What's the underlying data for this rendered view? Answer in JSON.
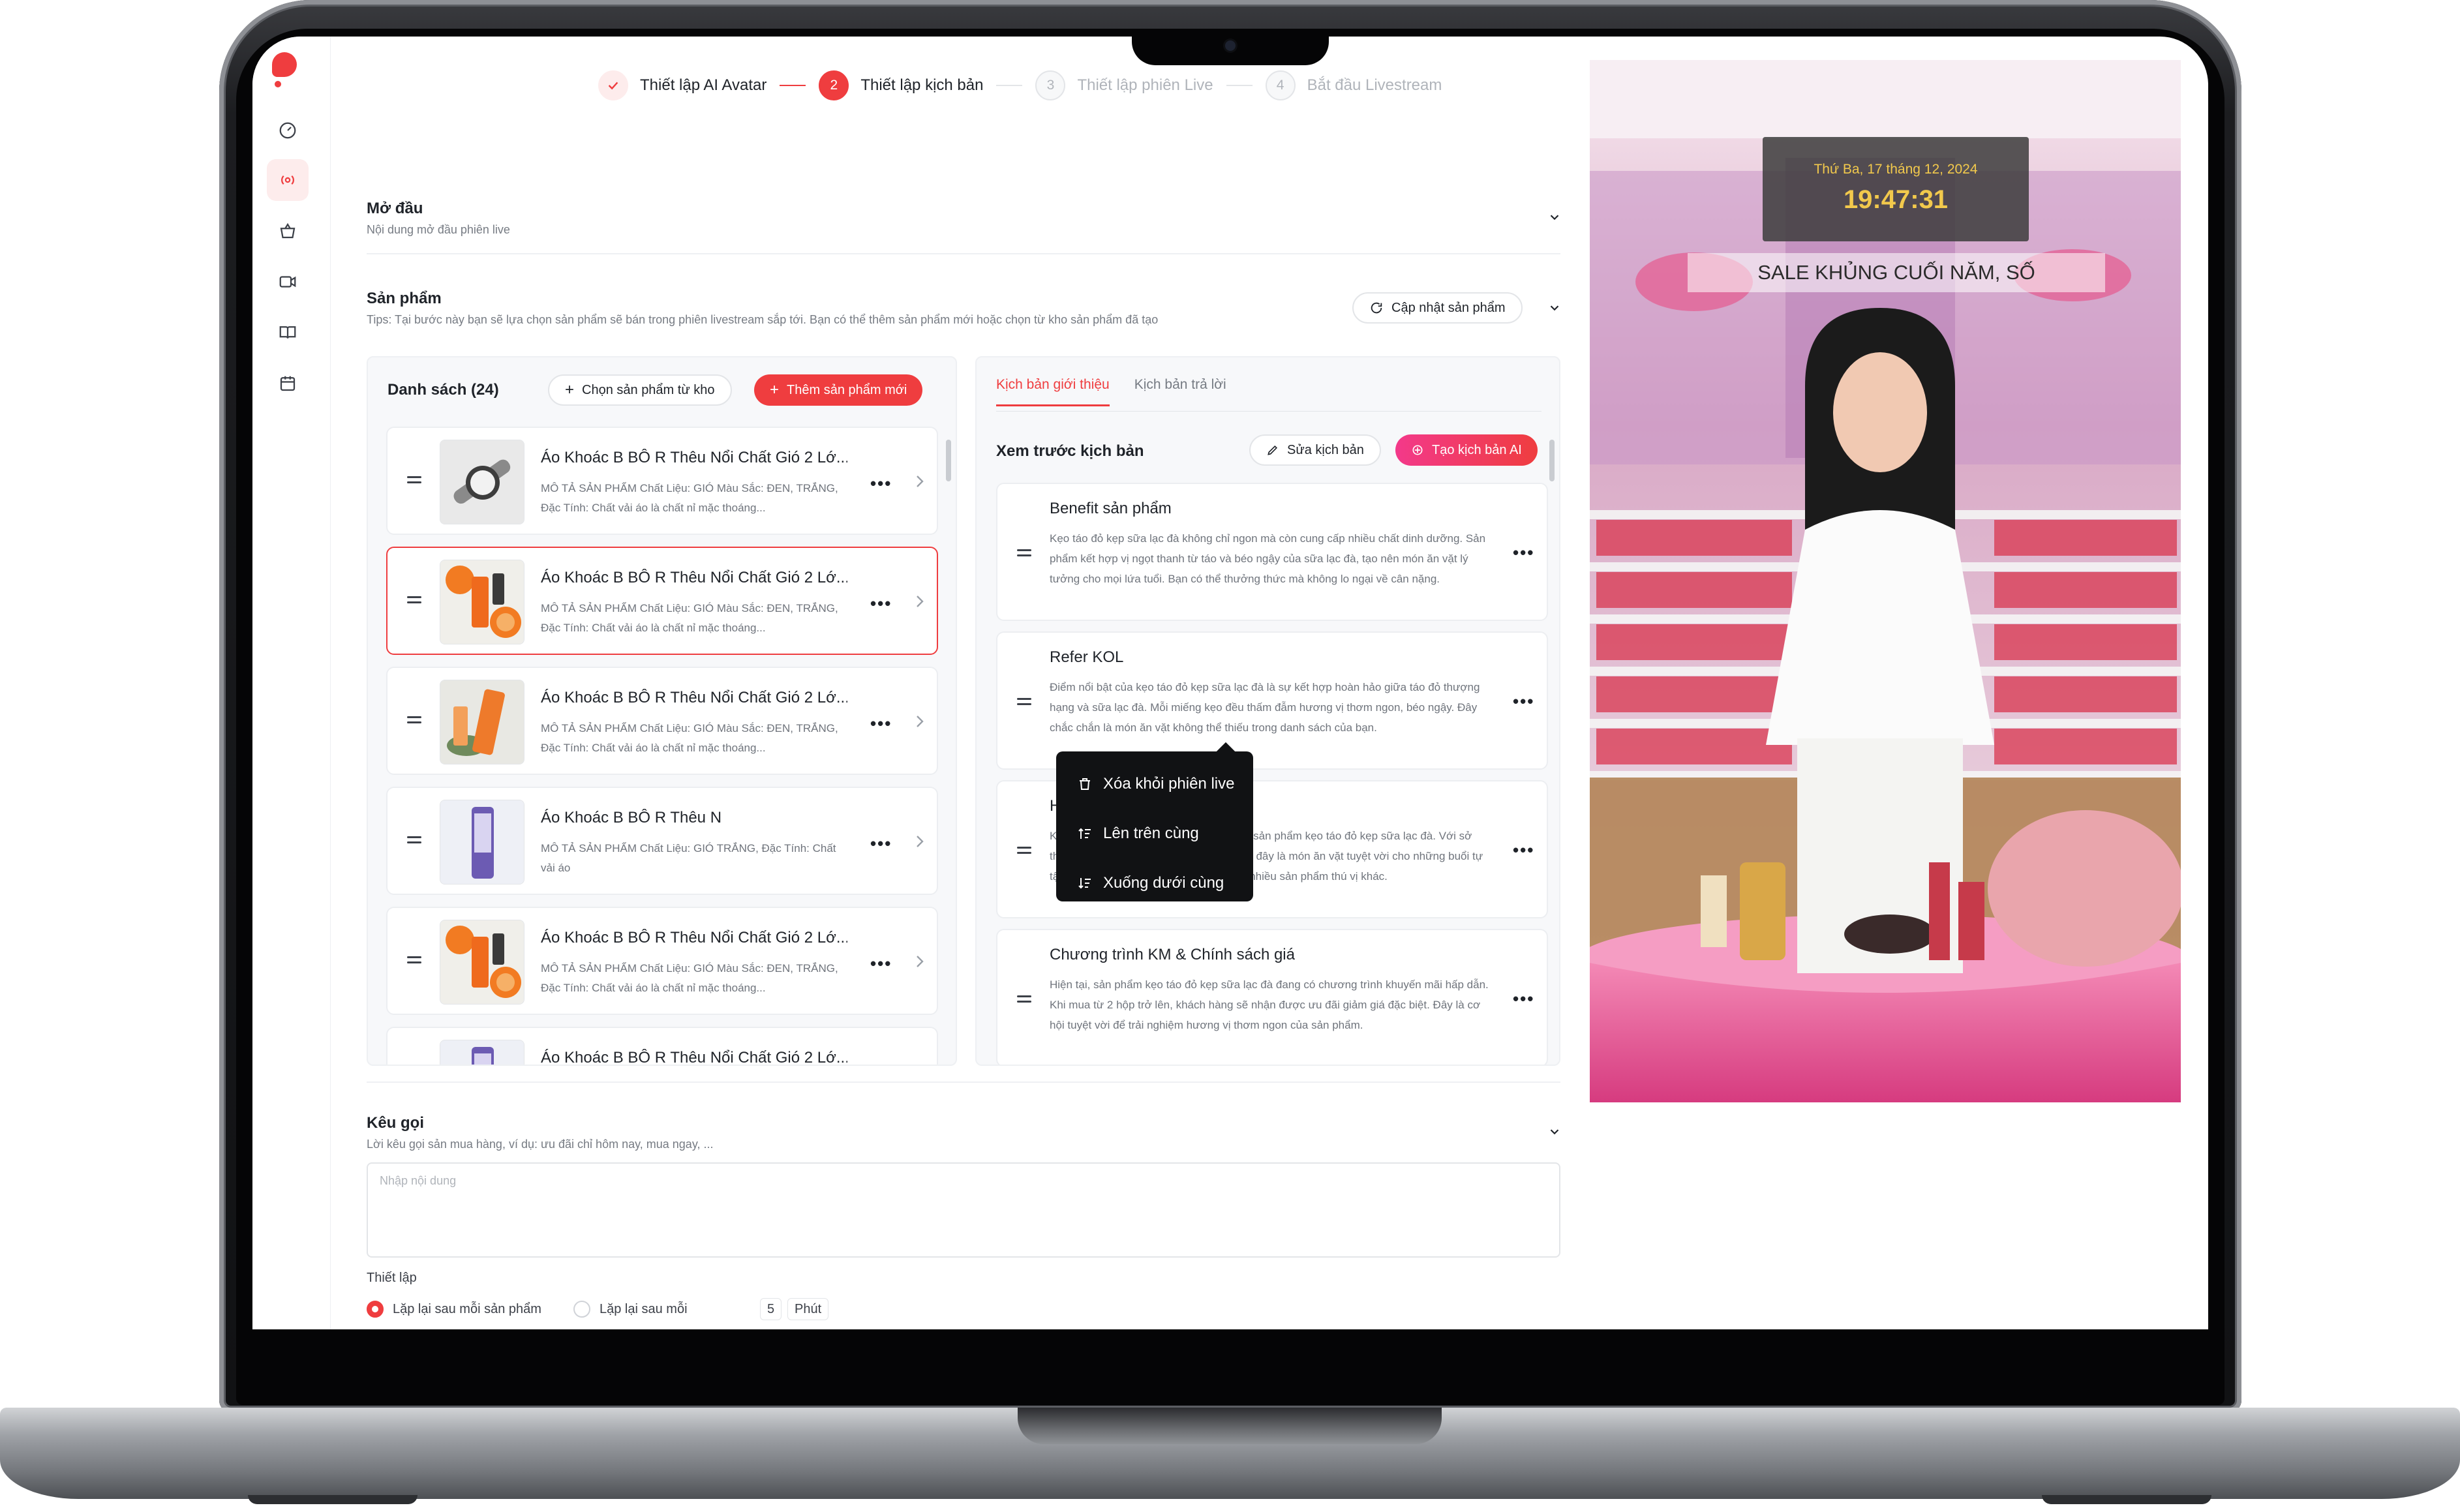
{
  "stepper": [
    {
      "num": "",
      "label": "Thiết lập AI Avatar",
      "state": "done"
    },
    {
      "num": "2",
      "label": "Thiết lập kịch bản",
      "state": "active"
    },
    {
      "num": "3",
      "label": "Thiết lập phiên Live",
      "state": "pending"
    },
    {
      "num": "4",
      "label": "Bắt đầu Livestream",
      "state": "pending"
    }
  ],
  "intro": {
    "title": "Mở đầu",
    "subtitle": "Nội dung mở đầu phiên live"
  },
  "products_section": {
    "title": "Sản phẩm",
    "tips": "Tips: Tại bước này bạn sẽ lựa chọn sản phẩm sẽ bán trong phiên livestream sắp tới. Bạn có thể thêm sản phẩm mới hoặc chọn từ kho sản phẩm đã tạo",
    "update_button": "Cập nhật sản phẩm"
  },
  "product_list": {
    "heading": "Danh sách (24)",
    "choose_button": "Chọn sản phẩm từ kho",
    "add_button": "Thêm sản phẩm mới",
    "items": [
      {
        "title": "Áo Khoác B BÔ R Thêu Nổi Chất Gió 2 Lớ...",
        "desc": "MÔ TẢ SẢN PHẨM Chất Liệu: GIÓ Màu Sắc: ĐEN, TRẮNG, Đặc Tính: Chất vải áo là chất nỉ mặc thoáng...",
        "thumb": "watch",
        "selected": false
      },
      {
        "title": "Áo Khoác B BÔ R Thêu Nổi Chất Gió 2 Lớ...",
        "desc": "MÔ TẢ SẢN PHẨM Chất Liệu: GIÓ Màu Sắc: ĐEN, TRẮNG, Đặc Tính: Chất vải áo là chất nỉ mặc thoáng...",
        "thumb": "orange",
        "selected": true
      },
      {
        "title": "Áo Khoác B BÔ R Thêu Nổi Chất Gió 2 Lớ...",
        "desc": "MÔ TẢ SẢN PHẨM Chất Liệu: GIÓ Màu Sắc: ĐEN, TRẮNG, Đặc Tính: Chất vải áo là chất nỉ mặc thoáng...",
        "thumb": "tube",
        "selected": false
      },
      {
        "title": "Áo Khoác B BÔ R Thêu N",
        "desc": "MÔ TẢ SẢN PHẨM Chất Liệu: GIÓ TRẮNG, Đặc Tính: Chất vải áo",
        "thumb": "purple",
        "selected": false
      },
      {
        "title": "Áo Khoác B BÔ R Thêu Nổi Chất Gió 2 Lớ...",
        "desc": "MÔ TẢ SẢN PHẨM Chất Liệu: GIÓ Màu Sắc: ĐEN, TRẮNG, Đặc Tính: Chất vải áo là chất nỉ mặc thoáng...",
        "thumb": "orange",
        "selected": false
      },
      {
        "title": "Áo Khoác B BÔ R Thêu Nổi Chất Gió 2 Lớ...",
        "desc": "",
        "thumb": "purple",
        "selected": false
      }
    ]
  },
  "context_menu": [
    {
      "label": "Xóa khỏi phiên live",
      "icon": "trash-icon"
    },
    {
      "label": "Lên trên cùng",
      "icon": "move-top-icon"
    },
    {
      "label": "Xuống dưới cùng",
      "icon": "move-bottom-icon"
    }
  ],
  "script_panel": {
    "tabs": [
      "Kịch bản giới thiệu",
      "Kịch bản trả lời"
    ],
    "preview_title": "Xem trước kịch bản",
    "edit_button": "Sửa kịch bản",
    "ai_button": "Tạo kịch bản AI",
    "cards": [
      {
        "title": "Benefit sản phẩm",
        "desc": "Kẹo táo đỏ kẹp sữa lạc đà không chỉ ngon mà còn cung cấp nhiều chất dinh dưỡng. Sản phẩm kết hợp vị ngọt thanh từ táo và béo ngậy của sữa lạc đà, tạo nên món ăn vặt lý tưởng cho mọi lứa tuổi. Bạn có thể thưởng thức mà không lo ngại về cân nặng."
      },
      {
        "title": "Refer KOL",
        "desc": "Điểm nổi bật của kẹo táo đỏ kẹp sữa lạc đà là sự kết hợp hoàn hảo giữa táo đỏ thượng hạng và sữa lạc đà. Mỗi miếng kẹo đều thấm đẫm hương vị thơm ngon, béo ngậy. Đây chắc chắn là món ăn vặt không thể thiếu trong danh sách của bạn."
      },
      {
        "title": "Hướng dẫn cách sử dụng",
        "desc": "KOL Linh đã trải nghiệm và đánh giá cao sản phẩm kẹo táo đỏ kẹp sữa lạc đà. Với sở thích trang điểm và nấu nướng, Linh thấy đây là món ăn vặt tuyệt vời cho những buổi tự tập. Hãy theo dõi Linh để cập nhật thêm nhiều sản phẩm thú vị khác."
      },
      {
        "title": "Chương trình KM & Chính sách giá",
        "desc": "Hiện tại, sản phẩm kẹo táo đỏ kẹp sữa lạc đà đang có chương trình khuyến mãi hấp dẫn. Khi mua từ 2 hộp trở lên, khách hàng sẽ nhận được ưu đãi giảm giá đặc biệt. Đây là cơ hội tuyệt vời để trải nghiệm hương vị thơm ngon của sản phẩm."
      }
    ]
  },
  "cta": {
    "title": "Kêu gọi",
    "subtitle": "Lời kêu gọi sản mua hàng, ví dụ: ưu đãi chỉ hôm nay, mua ngay, ...",
    "placeholder": "Nhập nội dung",
    "settings_label": "Thiết lập",
    "option_1": "Lặp lại sau mỗi sản phẩm",
    "option_2": "Lặp lại sau mỗi",
    "interval_value": "5",
    "interval_unit": "Phút",
    "selected_option": 1
  },
  "video": {
    "date": "Thứ Ba, 17 tháng 12, 2024",
    "time": "19:47:31",
    "banner": "SALE KHỦNG CUỐI NĂM, SỐ"
  },
  "colors": {
    "accent": "#ef3d3f",
    "ai_gradient_start": "#f3398a"
  }
}
